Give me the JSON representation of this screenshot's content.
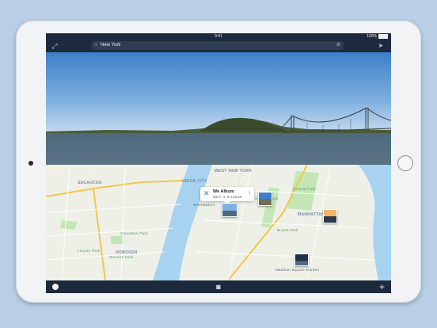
{
  "status_bar": {
    "time": "9:41",
    "carrier": "",
    "battery": "100%"
  },
  "nav": {
    "search_value": "New York"
  },
  "map": {
    "labels": [
      {
        "text": "UNION CITY",
        "kind": "area"
      },
      {
        "text": "WEST NEW YORK",
        "kind": "area"
      },
      {
        "text": "SECAUCUS",
        "kind": "area"
      },
      {
        "text": "MANHATTAN",
        "kind": "area"
      },
      {
        "text": "HOBOKEN",
        "kind": "area"
      },
      {
        "text": "Weehawken",
        "kind": "area"
      },
      {
        "text": "Central Park",
        "kind": "park"
      },
      {
        "text": "Riverside Park",
        "kind": "park"
      },
      {
        "text": "Lincoln Park",
        "kind": "park"
      },
      {
        "text": "Columbus Park",
        "kind": "park"
      },
      {
        "text": "Stevens Park",
        "kind": "park"
      },
      {
        "text": "Bryant Park",
        "kind": "park"
      },
      {
        "text": "Madison Square Garden",
        "kind": "poi"
      }
    ],
    "callout": {
      "title": "We Album",
      "date": "2017. 4. 8  0:42:53"
    }
  },
  "colors": {
    "bar": "#1d2a3d",
    "water": "#a7d3f0",
    "land": "#eef0e8",
    "park": "#c4e6b7",
    "accent": "#2f7be0",
    "background": "#b9cfe6"
  },
  "icons": {
    "expand": "expand-icon",
    "search": "search-icon",
    "settings": "gear-icon",
    "locate": "location-arrow-icon",
    "close": "close-icon",
    "share": "arrow-up-icon",
    "camera": "camera-icon",
    "add": "plus-icon"
  }
}
